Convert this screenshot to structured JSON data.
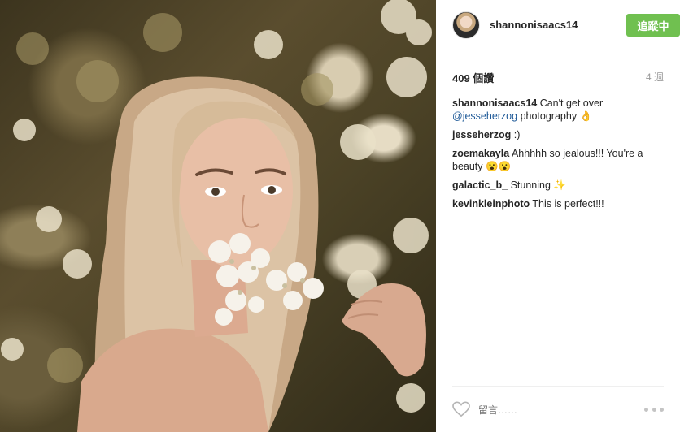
{
  "post": {
    "username": "shannonisaacs14",
    "follow_label": "追蹤中",
    "likes": "409 個讚",
    "time": "4 週"
  },
  "comments": [
    {
      "user": "shannonisaacs14",
      "text_before": " Can't get over ",
      "mention": "@jesseherzog",
      "text_after": " photography 👌"
    },
    {
      "user": "jesseherzog",
      "text": " :)"
    },
    {
      "user": "zoemakayla",
      "text": " Ahhhhh so jealous!!! You're a beauty 😮😮"
    },
    {
      "user": "galactic_b_",
      "text": " Stunning ✨"
    },
    {
      "user": "kevinkleinphoto",
      "text": " This is perfect!!!"
    }
  ],
  "footer": {
    "comment_placeholder": "留言……",
    "like_icon": "heart-icon",
    "more_icon": "ellipsis-icon"
  },
  "colors": {
    "follow_button": "#70c050",
    "mention": "#1f5a98"
  }
}
